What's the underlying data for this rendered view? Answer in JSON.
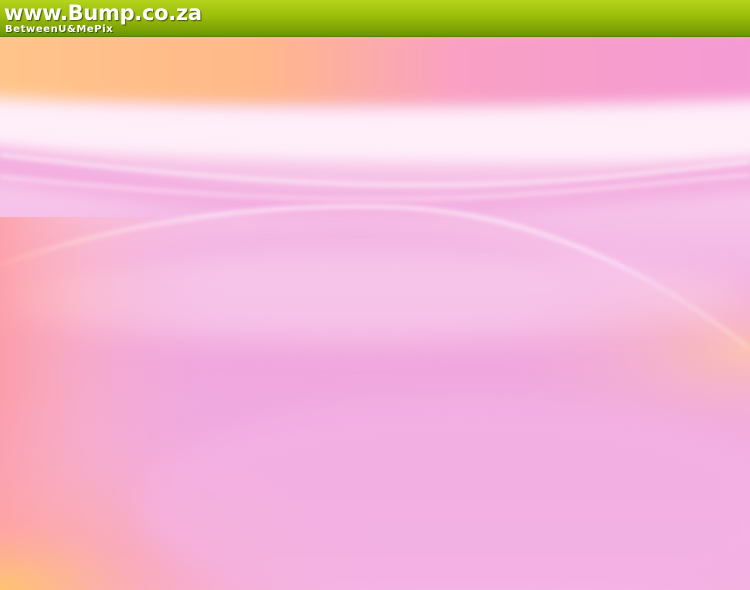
{
  "header": {
    "title": "www.Bump.co.za",
    "subtitle": "BetweenU&MePix"
  },
  "colors": {
    "header_green": "#9cbe0a",
    "background_pink": "#f2aee0",
    "accent_orange": "#ffc07a",
    "highlight_white": "#ffffff"
  }
}
